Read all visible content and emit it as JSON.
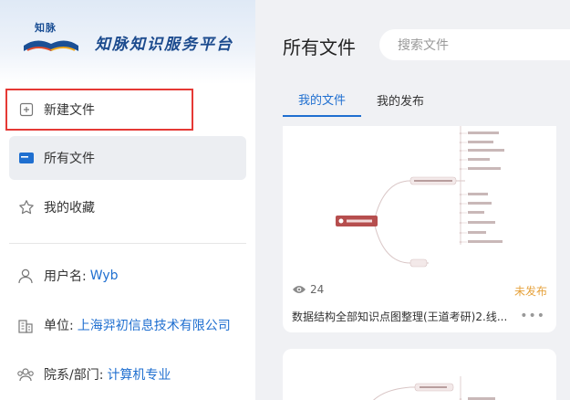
{
  "brand": {
    "stamp": "知脉",
    "name": "知脉知识服务平台"
  },
  "sidebar": {
    "new_file": "新建文件",
    "all_files": "所有文件",
    "favorites": "我的收藏"
  },
  "profile": {
    "user_label": "用户名:",
    "user_value": "Wyb",
    "unit_label": "单位:",
    "unit_value": "上海羿初信息技术有限公司",
    "dept_label": "院系/部门:",
    "dept_value": "计算机专业"
  },
  "main": {
    "title": "所有文件",
    "search_placeholder": "搜索文件",
    "tabs": [
      "我的文件",
      "我的发布"
    ]
  },
  "cards": [
    {
      "views": "24",
      "status": "未发布",
      "name": "数据结构全部知识点图整理(王道考研)2.线...",
      "more": "•••"
    }
  ],
  "colors": {
    "accent": "#1f6fd0",
    "unpublished": "#e6a23c",
    "highlight_border": "#e53935"
  }
}
